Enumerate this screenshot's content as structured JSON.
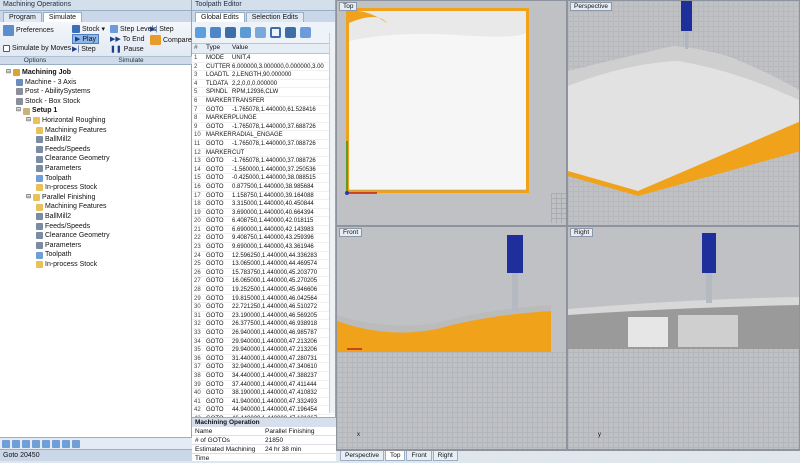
{
  "app": {
    "title": "Machining Operations",
    "editor_title": "Toolpath Editor"
  },
  "ribbon": {
    "tabs": [
      "Program",
      "Simulate"
    ],
    "preferences": "Preferences",
    "simulate_by_moves": "Simulate by Moves",
    "stock": "Stock",
    "step_levels": "Step Levels",
    "step_top": "Step",
    "play": "Play",
    "to_end": "To End",
    "compare": "Compare",
    "step_bottom": "Step",
    "pause": "Pause",
    "group_options": "Options",
    "group_simulate": "Simulate"
  },
  "tree": [
    {
      "label": "Machining Job",
      "bold": true,
      "indent": 0,
      "icon": "job-icon",
      "color": "#d9a431"
    },
    {
      "label": "Machine - 3 Axis",
      "indent": 1,
      "icon": "machine-icon",
      "color": "#6c8cc0"
    },
    {
      "label": "Post - AbilitySystems",
      "indent": 1,
      "icon": "post-icon",
      "color": "#8a8f99"
    },
    {
      "label": "Stock - Box Stock",
      "indent": 1,
      "icon": "stock-icon",
      "color": "#8a8f99"
    },
    {
      "label": "Setup 1",
      "bold": true,
      "indent": 1,
      "icon": "setup-icon",
      "color": "#c9b37a"
    },
    {
      "label": "Horizontal Roughing",
      "indent": 2,
      "icon": "folder-icon",
      "color": "#e8c15a"
    },
    {
      "label": "Machining Features",
      "indent": 3,
      "icon": "features-icon",
      "color": "#e8c15a"
    },
    {
      "label": "BallMill2",
      "indent": 3,
      "icon": "tool-icon",
      "color": "#7a8ba3"
    },
    {
      "label": "Feeds/Speeds",
      "indent": 3,
      "icon": "feeds-icon",
      "color": "#7a8ba3"
    },
    {
      "label": "Clearance Geometry",
      "indent": 3,
      "icon": "clearance-icon",
      "color": "#7a8ba3"
    },
    {
      "label": "Parameters",
      "indent": 3,
      "icon": "parameters-icon",
      "color": "#7a8ba3"
    },
    {
      "label": "Toolpath",
      "indent": 3,
      "icon": "toolpath-icon",
      "color": "#6f9fd6"
    },
    {
      "label": "In-process Stock",
      "indent": 3,
      "icon": "stock-icon",
      "color": "#e8c15a"
    },
    {
      "label": "Parallel Finishing",
      "indent": 2,
      "icon": "folder-icon",
      "color": "#e8c15a"
    },
    {
      "label": "Machining Features",
      "indent": 3,
      "icon": "features-icon",
      "color": "#e8c15a"
    },
    {
      "label": "BallMill2",
      "indent": 3,
      "icon": "tool-icon",
      "color": "#7a8ba3"
    },
    {
      "label": "Feeds/Speeds",
      "indent": 3,
      "icon": "feeds-icon",
      "color": "#7a8ba3"
    },
    {
      "label": "Clearance Geometry",
      "indent": 3,
      "icon": "clearance-icon",
      "color": "#7a8ba3"
    },
    {
      "label": "Parameters",
      "indent": 3,
      "icon": "parameters-icon",
      "color": "#7a8ba3"
    },
    {
      "label": "Toolpath",
      "indent": 3,
      "icon": "toolpath-icon",
      "color": "#6f9fd6"
    },
    {
      "label": "In-process Stock",
      "indent": 3,
      "icon": "stock-icon",
      "color": "#e8c15a"
    }
  ],
  "status": {
    "text": "Goto 20450"
  },
  "editor": {
    "tabs": [
      "Global Edits",
      "Selection Edits"
    ],
    "columns": [
      "#",
      "Type",
      "Value"
    ],
    "rows": [
      [
        "1",
        "MODE",
        "UNIT,4"
      ],
      [
        "2",
        "CUTTER",
        "6.000000,3.000000,0.000000,3.00"
      ],
      [
        "3",
        "LOADTL",
        "2,LENGTH,90.000000"
      ],
      [
        "4",
        "TLDATA",
        "2,2,0,0,0.000000"
      ],
      [
        "5",
        "SPINDL",
        "RPM,12936,CLW"
      ],
      [
        "6",
        "MARKER",
        "TRANSFER"
      ],
      [
        "7",
        "GOTO",
        "-1.765078,1.440000,61.528416"
      ],
      [
        "8",
        "MARKER",
        "PLUNGE"
      ],
      [
        "9",
        "GOTO",
        "-1.765078,1.440000,37.688726"
      ],
      [
        "10",
        "MARKER",
        "RADIAL_ENGAGE"
      ],
      [
        "11",
        "GOTO",
        "-1.765078,1.440000,37.088726"
      ],
      [
        "12",
        "MARKER",
        "CUT"
      ],
      [
        "13",
        "GOTO",
        "-1.765078,1.440000,37.088726"
      ],
      [
        "14",
        "GOTO",
        "-1.560000,1.440000,37.250536"
      ],
      [
        "15",
        "GOTO",
        "-0.425000,1.440000,38.088515"
      ],
      [
        "16",
        "GOTO",
        "0.877500,1.440000,38.985684"
      ],
      [
        "17",
        "GOTO",
        "1.158750,1.440000,39.164088"
      ],
      [
        "18",
        "GOTO",
        "3.315000,1.440000,40.450844"
      ],
      [
        "19",
        "GOTO",
        "3.690000,1.440000,40.664394"
      ],
      [
        "20",
        "GOTO",
        "6.408750,1.440000,42.018115"
      ],
      [
        "21",
        "GOTO",
        "6.690000,1.440000,42.143983"
      ],
      [
        "22",
        "GOTO",
        "9.408750,1.440000,43.259396"
      ],
      [
        "23",
        "GOTO",
        "9.690000,1.440000,43.361946"
      ],
      [
        "24",
        "GOTO",
        "12.596250,1.440000,44.336283"
      ],
      [
        "25",
        "GOTO",
        "13.065000,1.440000,44.469574"
      ],
      [
        "26",
        "GOTO",
        "15.783750,1.440000,45.203770"
      ],
      [
        "27",
        "GOTO",
        "16.065000,1.440000,45.270205"
      ],
      [
        "28",
        "GOTO",
        "19.252500,1.440000,45.946606"
      ],
      [
        "29",
        "GOTO",
        "19.815000,1.440000,46.042564"
      ],
      [
        "30",
        "GOTO",
        "22.721250,1.440000,46.510272"
      ],
      [
        "31",
        "GOTO",
        "23.190000,1.440000,46.569205"
      ],
      [
        "32",
        "GOTO",
        "26.377500,1.440000,46.938918"
      ],
      [
        "33",
        "GOTO",
        "26.940000,1.440000,46.985787"
      ],
      [
        "34",
        "GOTO",
        "29.940000,1.440000,47.213206"
      ],
      [
        "35",
        "GOTO",
        "29.940000,1.440000,47.213206"
      ],
      [
        "36",
        "GOTO",
        "31.440000,1.440000,47.280731"
      ],
      [
        "37",
        "GOTO",
        "32.940000,1.440000,47.340610"
      ],
      [
        "38",
        "GOTO",
        "34.440000,1.440000,47.388237"
      ],
      [
        "39",
        "GOTO",
        "37.440000,1.440000,47.411444"
      ],
      [
        "40",
        "GOTO",
        "38.190000,1.440000,47.410832"
      ],
      [
        "41",
        "GOTO",
        "41.940000,1.440000,47.332493"
      ],
      [
        "42",
        "GOTO",
        "44.940000,1.440000,47.196454"
      ],
      [
        "43",
        "GOTO",
        "46.440000,1.440000,47.121067"
      ],
      [
        "44",
        "GOTO",
        "49.440000,1.440000,46.912773"
      ],
      [
        "45",
        "GOTO",
        "50.940000,1.440000,46.799953"
      ]
    ]
  },
  "operation": {
    "header": "Machining Operation",
    "rows": [
      [
        "Name",
        "Parallel Finishing"
      ],
      [
        "# of GOTOs",
        "21850"
      ],
      [
        "Estimated Machining Time",
        "24 hr 38 min"
      ]
    ]
  },
  "viewports": {
    "top": "Top",
    "perspective": "Perspective",
    "front": "Front",
    "right": "Right",
    "axis_x": "x",
    "axis_y": "y",
    "axis_z": "z",
    "tabs": [
      "Perspective",
      "Top",
      "Front",
      "Right"
    ],
    "active_tab": "Top"
  },
  "colors": {
    "stock": "#f0a21a",
    "tool_blue": "#1e2f9c",
    "bg": "#bfc1c5"
  }
}
